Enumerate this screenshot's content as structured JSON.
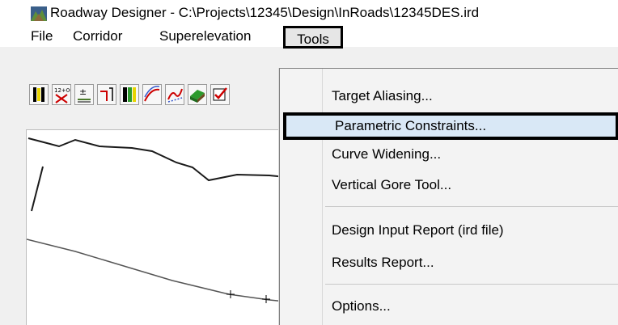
{
  "window": {
    "title": "Roadway Designer - C:\\Projects\\12345\\Design\\InRoads\\12345DES.ird"
  },
  "menubar": {
    "items": [
      {
        "label": "File"
      },
      {
        "label": "Corridor"
      },
      {
        "label": "Superelevation"
      },
      {
        "label": "Tools"
      }
    ]
  },
  "tools_menu": {
    "items": [
      {
        "label": "Target Aliasing..."
      },
      {
        "label": "Parametric Constraints..."
      },
      {
        "label": "Curve Widening..."
      },
      {
        "label": "Vertical Gore Tool..."
      },
      {
        "label": "Design Input Report (ird file)"
      },
      {
        "label": "Results Report..."
      },
      {
        "label": "Options..."
      }
    ]
  },
  "toolbar": {
    "buttons": [
      {
        "icon": "lane-icon"
      },
      {
        "icon": "station-icon"
      },
      {
        "icon": "plus-minus-icon"
      },
      {
        "icon": "step-icon"
      },
      {
        "icon": "template-icon"
      },
      {
        "icon": "curve-icon"
      },
      {
        "icon": "transition-icon"
      },
      {
        "icon": "surface-icon"
      },
      {
        "icon": "check-icon"
      }
    ]
  },
  "colors": {
    "menu_highlight": "#d9e8f6",
    "callout_border": "#000000"
  }
}
